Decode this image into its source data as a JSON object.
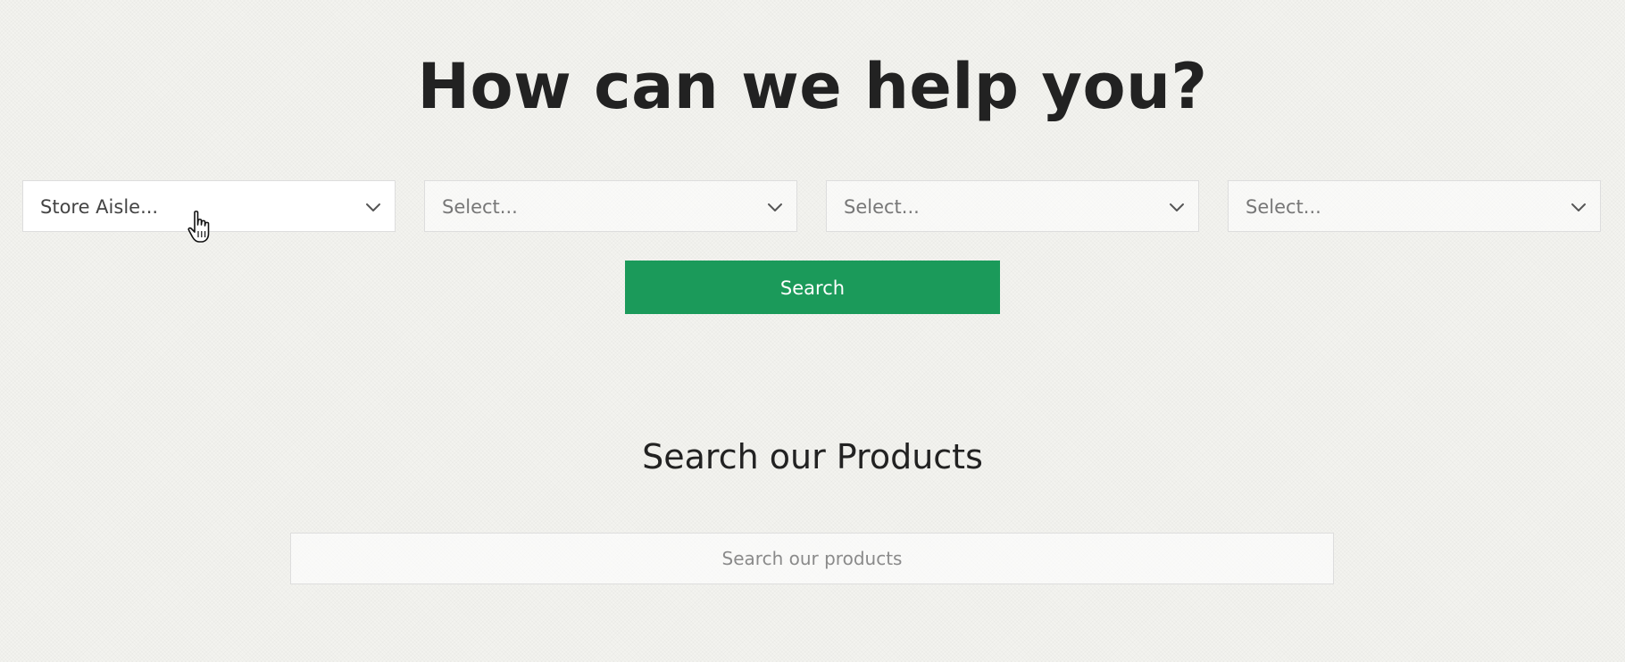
{
  "header": {
    "title": "How can we help you?"
  },
  "filters": {
    "selects": [
      {
        "value": "Store Aisle...",
        "icon": "chevron-down-icon"
      },
      {
        "value": "Select...",
        "icon": "chevron-down-icon"
      },
      {
        "value": "Select...",
        "icon": "chevron-down-icon"
      },
      {
        "value": "Select...",
        "icon": "chevron-down-icon"
      }
    ],
    "search_label": "Search"
  },
  "products": {
    "heading": "Search our Products",
    "search_placeholder": "Search our products"
  },
  "colors": {
    "accent": "#1b9a5a",
    "background": "#f3f3ef",
    "heading_text": "#222222"
  },
  "cursor": {
    "icon": "hand-pointer-icon"
  }
}
